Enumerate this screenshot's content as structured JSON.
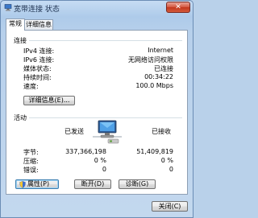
{
  "window": {
    "title": "宽带连接 状态",
    "close_glyph": "✕"
  },
  "tabs": [
    {
      "label": "常规",
      "active": true
    },
    {
      "label": "详细信息",
      "active": false
    }
  ],
  "connection": {
    "heading": "连接",
    "rows": [
      {
        "label": "IPv4 连接:",
        "value": "Internet"
      },
      {
        "label": "IPv6 连接:",
        "value": "无网络访问权限"
      },
      {
        "label": "媒体状态:",
        "value": "已连接"
      },
      {
        "label": "持续时间:",
        "value": "00:34:22"
      },
      {
        "label": "速度:",
        "value": "100.0 Mbps"
      }
    ],
    "details_button": "详细信息(E)..."
  },
  "activity": {
    "heading": "活动",
    "sent_label": "已发送",
    "received_label": "已接收",
    "rows": [
      {
        "label": "字节:",
        "sent": "337,366,198",
        "received": "51,409,819"
      },
      {
        "label": "压缩:",
        "sent": "0 %",
        "received": "0 %"
      },
      {
        "label": "错误:",
        "sent": "0",
        "received": "0"
      }
    ]
  },
  "buttons": {
    "properties": "属性(P)",
    "disable": "断开(D)",
    "diagnose": "诊断(G)",
    "close": "关闭(C)"
  },
  "icons": {
    "title": "network-connection-icon",
    "activity": "network-computer-icon",
    "shield": "shield-icon"
  }
}
